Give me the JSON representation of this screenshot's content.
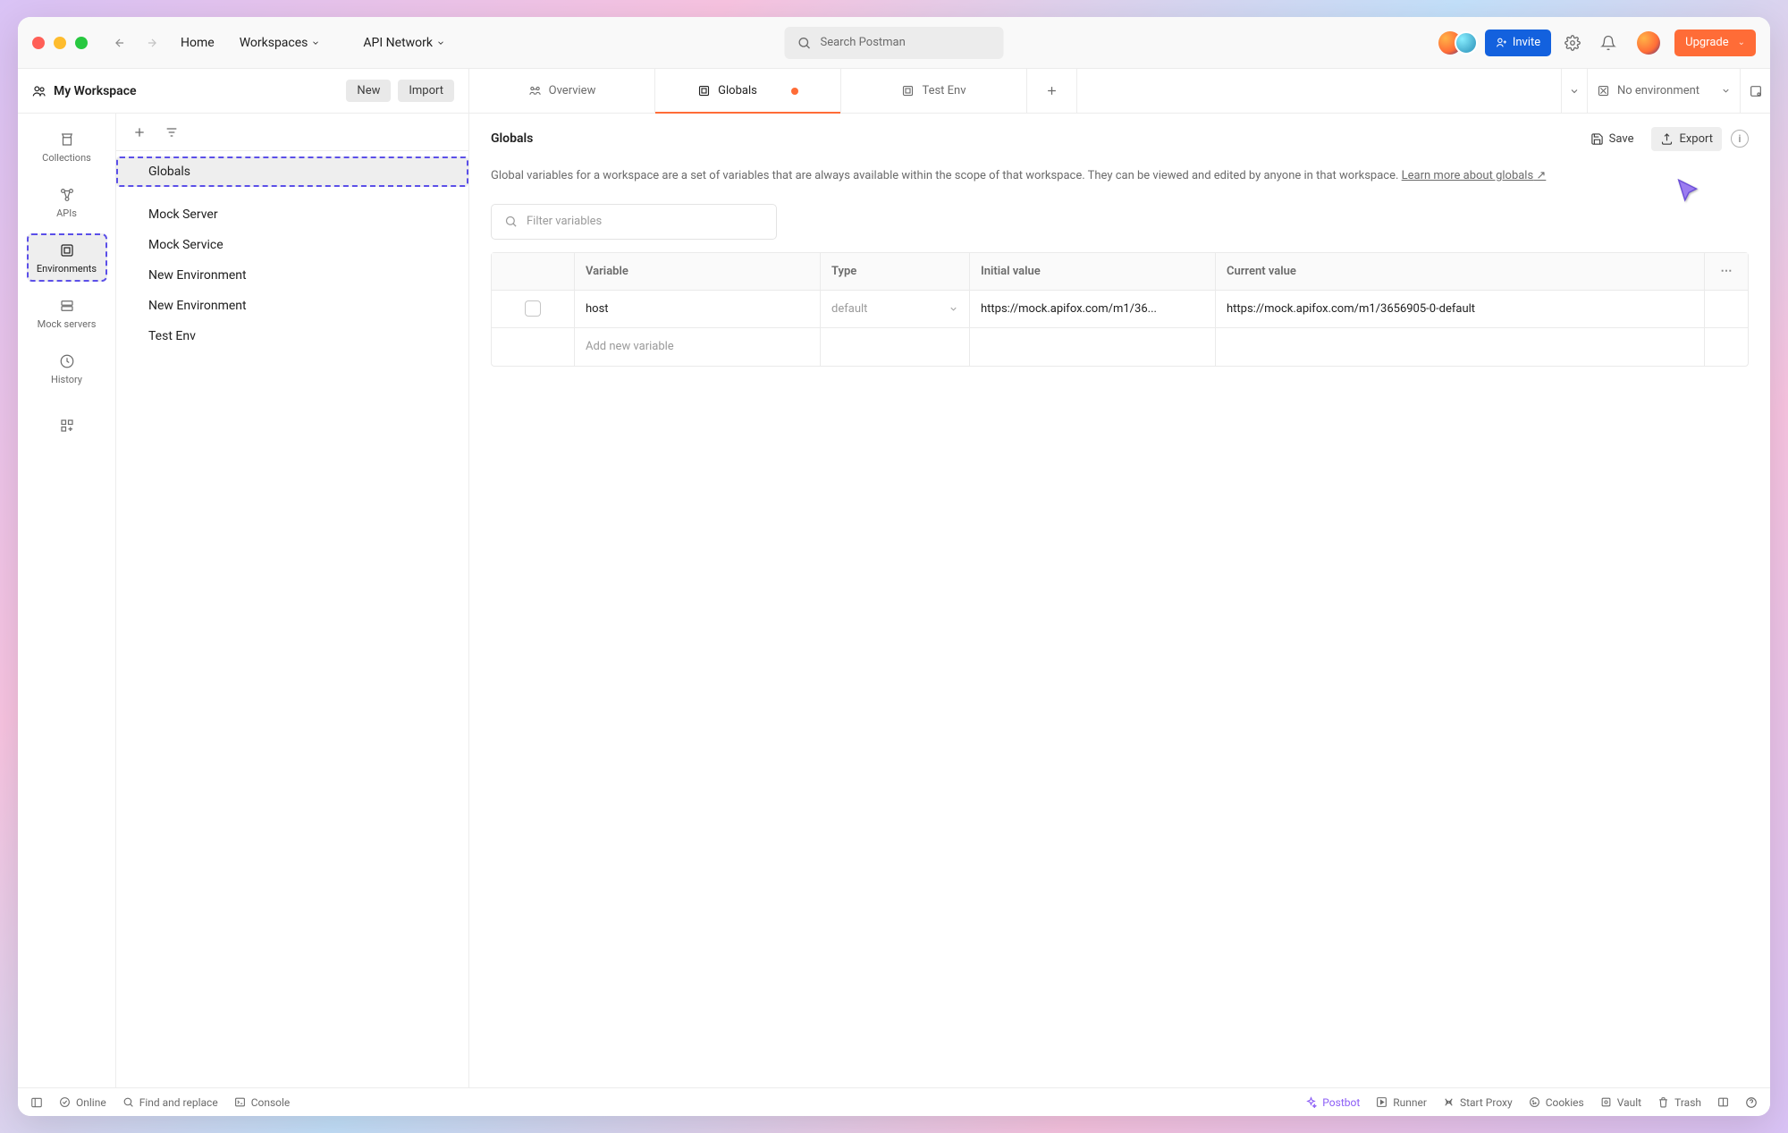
{
  "titlebar": {
    "home": "Home",
    "workspaces": "Workspaces",
    "api_network": "API Network",
    "search_placeholder": "Search Postman",
    "invite": "Invite",
    "upgrade": "Upgrade"
  },
  "workspace": {
    "name": "My Workspace",
    "new_btn": "New",
    "import_btn": "Import"
  },
  "side_nav": [
    {
      "label": "Collections"
    },
    {
      "label": "APIs"
    },
    {
      "label": "Environments"
    },
    {
      "label": "Mock servers"
    },
    {
      "label": "History"
    }
  ],
  "env_list": [
    "Globals",
    "Mock Server",
    "Mock Service",
    "New Environment",
    "New Environment",
    "Test Env"
  ],
  "tabs": {
    "overview": "Overview",
    "globals": "Globals",
    "test_env": "Test Env",
    "no_env": "No environment"
  },
  "content": {
    "title": "Globals",
    "save": "Save",
    "export": "Export",
    "desc_1": "Global variables for a workspace are a set of variables that are always available within the scope of that workspace. They can be viewed and edited by anyone in that workspace. ",
    "learn_more": "Learn more about globals",
    "filter_placeholder": "Filter variables"
  },
  "table": {
    "headers": {
      "variable": "Variable",
      "type": "Type",
      "initial": "Initial value",
      "current": "Current value"
    },
    "rows": [
      {
        "variable": "host",
        "type": "default",
        "initial": "https://mock.apifox.com/m1/36...",
        "current": "https://mock.apifox.com/m1/3656905-0-default"
      }
    ],
    "add_placeholder": "Add new variable"
  },
  "footer": {
    "online": "Online",
    "find": "Find and replace",
    "console": "Console",
    "postbot": "Postbot",
    "runner": "Runner",
    "start_proxy": "Start Proxy",
    "cookies": "Cookies",
    "vault": "Vault",
    "trash": "Trash"
  }
}
